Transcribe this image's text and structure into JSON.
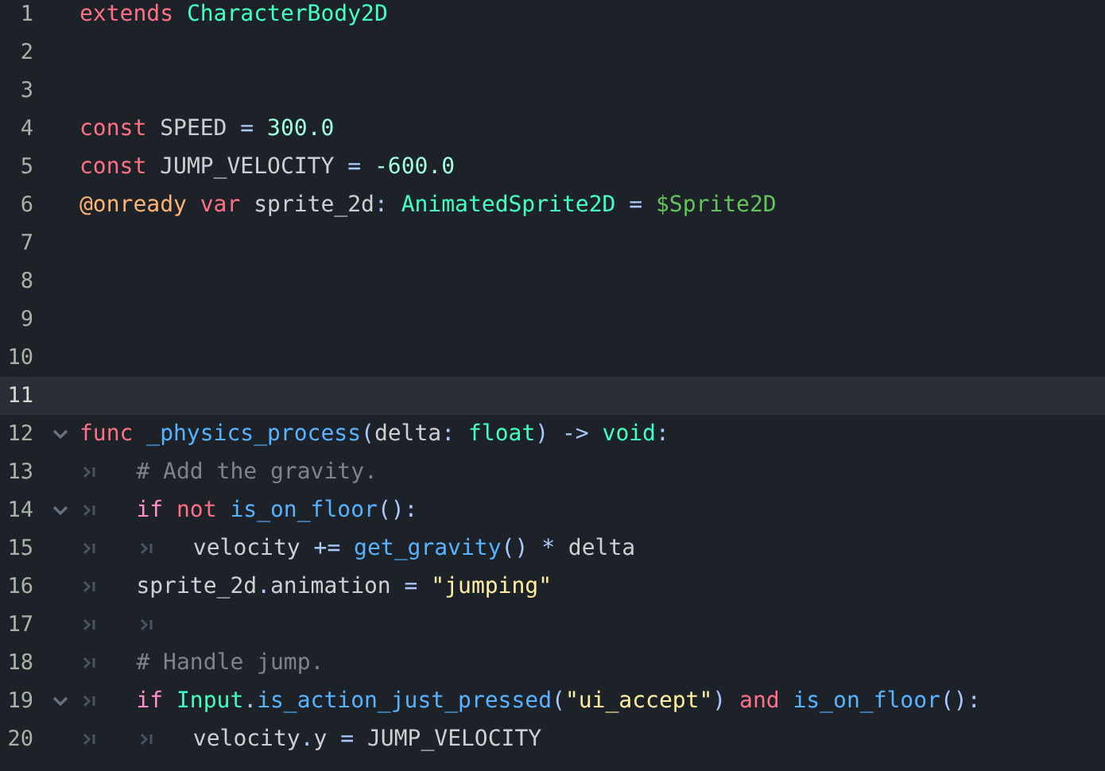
{
  "editor": {
    "lines": [
      {
        "number": "1",
        "current": false,
        "foldable": false,
        "tokens": [
          {
            "kind": "keyword",
            "text": "extends"
          },
          {
            "kind": "type",
            "text": " CharacterBody2D"
          }
        ]
      },
      {
        "number": "2",
        "current": false,
        "foldable": false
      },
      {
        "number": "3",
        "current": false,
        "foldable": false
      },
      {
        "number": "4",
        "current": false,
        "foldable": false,
        "tokens": [
          {
            "kind": "keyword",
            "text": "const"
          },
          {
            "kind": "text",
            "text": " SPEED "
          },
          {
            "kind": "symbol",
            "text": "="
          },
          {
            "kind": "number",
            "text": " 300.0"
          }
        ]
      },
      {
        "number": "5",
        "current": false,
        "foldable": false,
        "tokens": [
          {
            "kind": "keyword",
            "text": "const"
          },
          {
            "kind": "text",
            "text": " JUMP_VELOCITY "
          },
          {
            "kind": "symbol",
            "text": "="
          },
          {
            "kind": "number",
            "text": " -600.0"
          }
        ]
      },
      {
        "number": "6",
        "current": false,
        "foldable": false,
        "tokens": [
          {
            "kind": "annotation",
            "text": "@onready"
          },
          {
            "kind": "keyword",
            "text": " var"
          },
          {
            "kind": "text",
            "text": " sprite_2d"
          },
          {
            "kind": "symbol",
            "text": ":"
          },
          {
            "kind": "type",
            "text": " AnimatedSprite2D"
          },
          {
            "kind": "symbol",
            "text": " ="
          },
          {
            "kind": "nodepath",
            "text": " $Sprite2D"
          }
        ]
      },
      {
        "number": "7",
        "current": false,
        "foldable": false
      },
      {
        "number": "8",
        "current": false,
        "foldable": false
      },
      {
        "number": "9",
        "current": false,
        "foldable": false
      },
      {
        "number": "10",
        "current": false,
        "foldable": false
      },
      {
        "number": "11",
        "current": true,
        "foldable": false
      },
      {
        "number": "12",
        "current": false,
        "foldable": true,
        "tokens": [
          {
            "kind": "keyword",
            "text": "func"
          },
          {
            "kind": "function",
            "text": " _physics_process"
          },
          {
            "kind": "symbol",
            "text": "("
          },
          {
            "kind": "text",
            "text": "delta"
          },
          {
            "kind": "symbol",
            "text": ":"
          },
          {
            "kind": "type",
            "text": " float"
          },
          {
            "kind": "symbol",
            "text": ") ->"
          },
          {
            "kind": "type",
            "text": " void"
          },
          {
            "kind": "symbol",
            "text": ":"
          }
        ]
      },
      {
        "number": "13",
        "current": false,
        "foldable": false,
        "indent": [
          {
            "kind": "tab"
          }
        ],
        "tokens": [
          {
            "kind": "comment",
            "text": "# Add the gravity."
          }
        ]
      },
      {
        "number": "14",
        "current": false,
        "foldable": true,
        "indent": [
          {
            "kind": "tab"
          }
        ],
        "tokens": [
          {
            "kind": "control",
            "text": "if"
          },
          {
            "kind": "keyword",
            "text": " not"
          },
          {
            "kind": "function",
            "text": " is_on_floor"
          },
          {
            "kind": "symbol",
            "text": "():"
          }
        ]
      },
      {
        "number": "15",
        "current": false,
        "foldable": false,
        "indent": [
          {
            "kind": "tab"
          },
          {
            "kind": "tab"
          }
        ],
        "tokens": [
          {
            "kind": "text",
            "text": "velocity "
          },
          {
            "kind": "symbol",
            "text": "+="
          },
          {
            "kind": "function",
            "text": " get_gravity"
          },
          {
            "kind": "symbol",
            "text": "() *"
          },
          {
            "kind": "text",
            "text": " delta"
          }
        ]
      },
      {
        "number": "16",
        "current": false,
        "foldable": false,
        "indent": [
          {
            "kind": "tab"
          }
        ],
        "tokens": [
          {
            "kind": "text",
            "text": "sprite_2d"
          },
          {
            "kind": "symbol",
            "text": "."
          },
          {
            "kind": "text",
            "text": "animation "
          },
          {
            "kind": "symbol",
            "text": "="
          },
          {
            "kind": "string",
            "text": " \"jumping\""
          }
        ]
      },
      {
        "number": "17",
        "current": false,
        "foldable": false,
        "indent": [
          {
            "kind": "tab"
          },
          {
            "kind": "tab"
          }
        ]
      },
      {
        "number": "18",
        "current": false,
        "foldable": false,
        "indent": [
          {
            "kind": "tab"
          }
        ],
        "tokens": [
          {
            "kind": "comment",
            "text": "# Handle jump."
          }
        ]
      },
      {
        "number": "19",
        "current": false,
        "foldable": true,
        "indent": [
          {
            "kind": "tab"
          }
        ],
        "tokens": [
          {
            "kind": "control",
            "text": "if"
          },
          {
            "kind": "type",
            "text": " Input"
          },
          {
            "kind": "symbol",
            "text": "."
          },
          {
            "kind": "function",
            "text": "is_action_just_pressed"
          },
          {
            "kind": "symbol",
            "text": "("
          },
          {
            "kind": "string",
            "text": "\"ui_accept\""
          },
          {
            "kind": "symbol",
            "text": ")"
          },
          {
            "kind": "keyword",
            "text": " and"
          },
          {
            "kind": "function",
            "text": " is_on_floor"
          },
          {
            "kind": "symbol",
            "text": "():"
          }
        ]
      },
      {
        "number": "20",
        "current": false,
        "foldable": false,
        "indent": [
          {
            "kind": "tab"
          },
          {
            "kind": "tab"
          }
        ],
        "tokens": [
          {
            "kind": "text",
            "text": "velocity"
          },
          {
            "kind": "symbol",
            "text": "."
          },
          {
            "kind": "text",
            "text": "y "
          },
          {
            "kind": "symbol",
            "text": "="
          },
          {
            "kind": "text",
            "text": " JUMP_VELOCITY"
          }
        ]
      }
    ]
  }
}
